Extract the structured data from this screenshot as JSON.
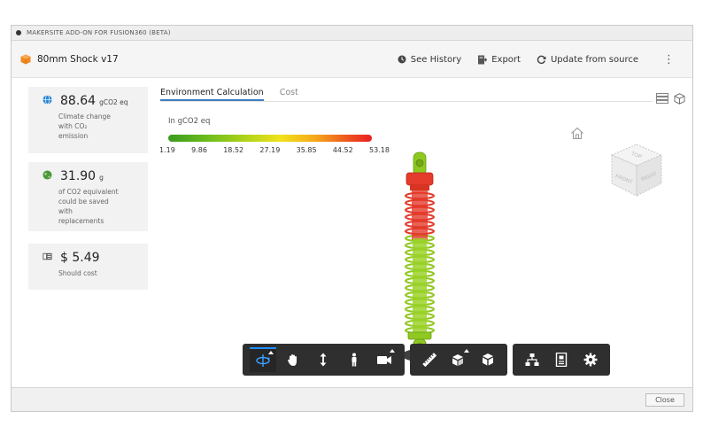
{
  "window": {
    "title": "MAKERSITE ADD-ON FOR FUSION360 (BETA)"
  },
  "header": {
    "project_name": "80mm Shock v17",
    "actions": {
      "history": "See History",
      "export": "Export",
      "update": "Update from source"
    }
  },
  "cards": {
    "climate": {
      "value": "88.64",
      "unit": "gCO2 eq",
      "desc_lines": [
        "Climate change",
        "with CO₂",
        "emission"
      ]
    },
    "savings": {
      "value": "31.90",
      "unit": "g",
      "desc_lines": [
        "of CO2 equivalent",
        "could be saved",
        "with",
        "replacements"
      ]
    },
    "cost": {
      "value": "$ 5.49",
      "desc": "Should cost"
    }
  },
  "tabs": [
    {
      "label": "Environment Calculation",
      "active": true
    },
    {
      "label": "Cost",
      "active": false
    }
  ],
  "legend": {
    "title": "In gCO2 eq",
    "ticks": [
      "1.19",
      "9.86",
      "18.52",
      "27.19",
      "35.85",
      "44.52",
      "53.18"
    ],
    "colors": [
      "#3a9b1f",
      "#6fbd1c",
      "#b6d61a",
      "#f0e21a",
      "#f5a91a",
      "#ee5520",
      "#e82020"
    ]
  },
  "viewcube": {
    "top": "TOP",
    "front": "FRONT",
    "right": "RIGHT"
  },
  "toolbar": {
    "groups": [
      [
        "orbit-icon",
        "pan-icon",
        "zoom-icon",
        "walk-icon",
        "camera-icon"
      ],
      [
        "measure-icon",
        "explode-icon",
        "section-icon"
      ],
      [
        "model-tree-icon",
        "properties-icon",
        "settings-icon"
      ]
    ]
  },
  "footer": {
    "close": "Close"
  },
  "colors": {
    "accent": "#3d7fc1",
    "model_red": "#e43b2c",
    "model_green": "#8fc821"
  }
}
